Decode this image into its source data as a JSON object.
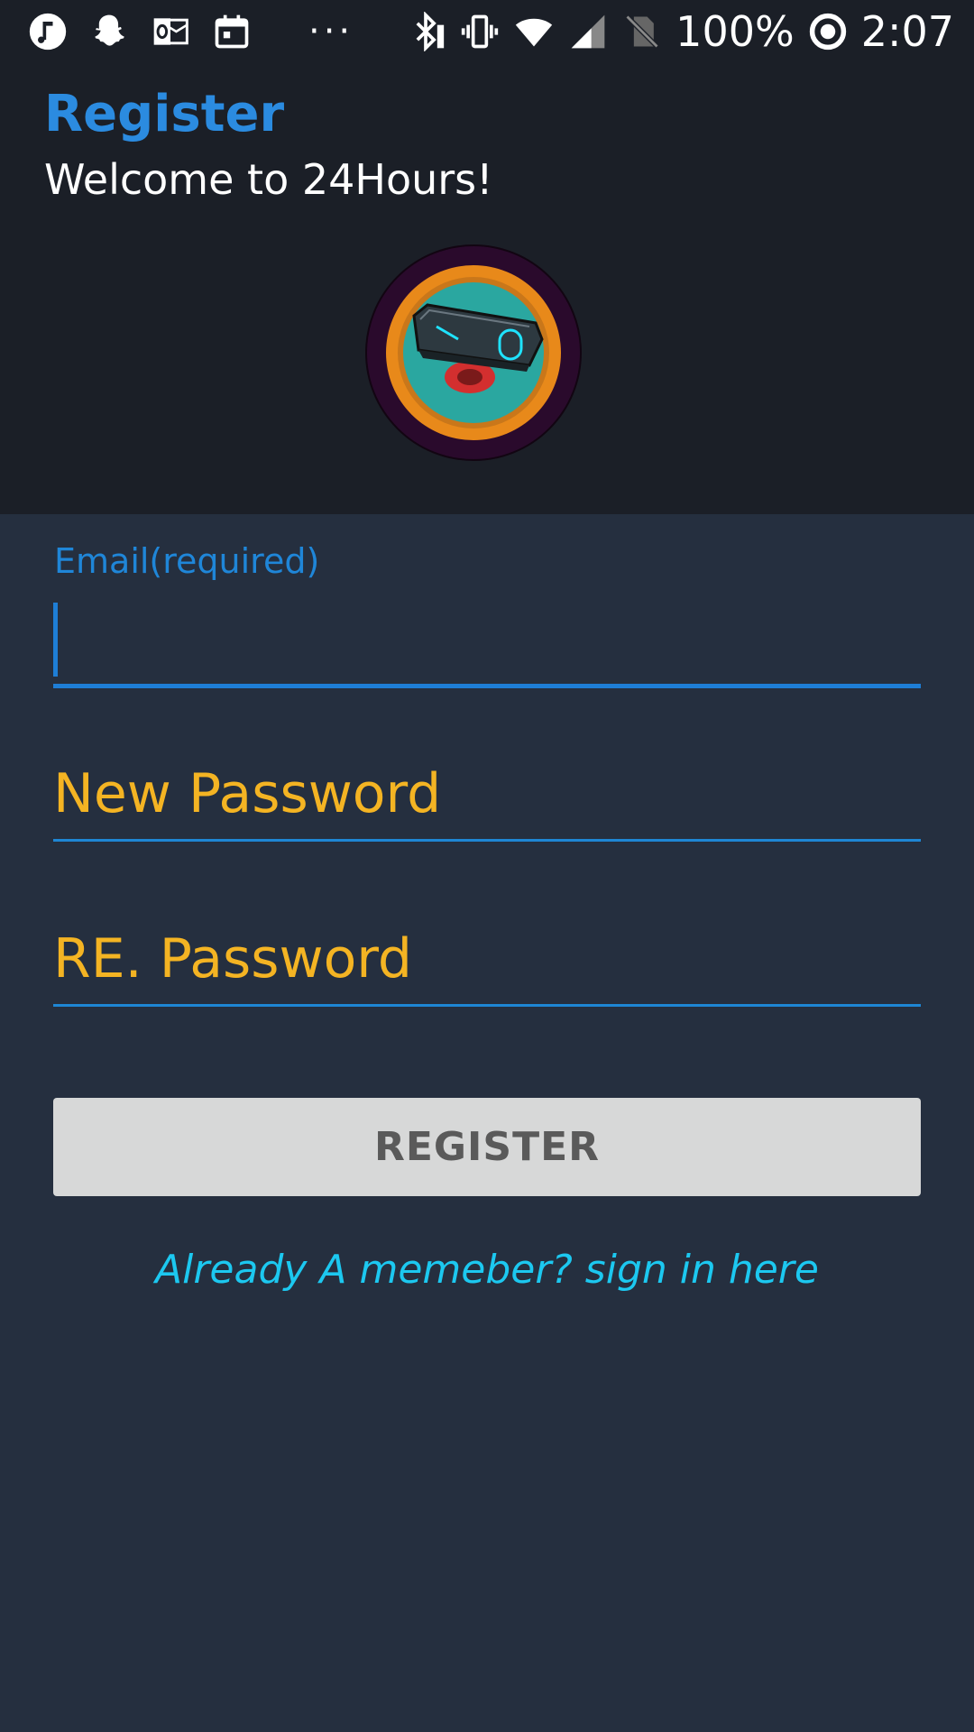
{
  "status_bar": {
    "left_icons": [
      "music-note-icon",
      "snapchat-ghost-icon",
      "outlook-icon",
      "calendar-icon"
    ],
    "overflow": "···",
    "right_icons": [
      "bluetooth-icon",
      "vibrate-icon",
      "wifi-icon",
      "signal-icon",
      "no-sim-icon"
    ],
    "battery": "100%",
    "sync_icon": "sync-icon",
    "time": "2:07"
  },
  "header": {
    "title": "Register",
    "subtitle": "Welcome to 24Hours!",
    "logo_icon": "app-logo"
  },
  "form": {
    "email": {
      "label": "Email(required)",
      "value": ""
    },
    "new_password": {
      "placeholder": "New Password",
      "value": ""
    },
    "re_password": {
      "placeholder": "RE. Password",
      "value": ""
    },
    "register_label": "REGISTER",
    "signin_link": "Already A memeber? sign in here"
  },
  "colors": {
    "header_bg": "#1b1f27",
    "body_bg": "#252f3f",
    "title_blue": "#2b8be0",
    "placeholder_yellow": "#f4b423",
    "link_cyan": "#1cc8f0",
    "button_gray": "#d7d8d8"
  }
}
